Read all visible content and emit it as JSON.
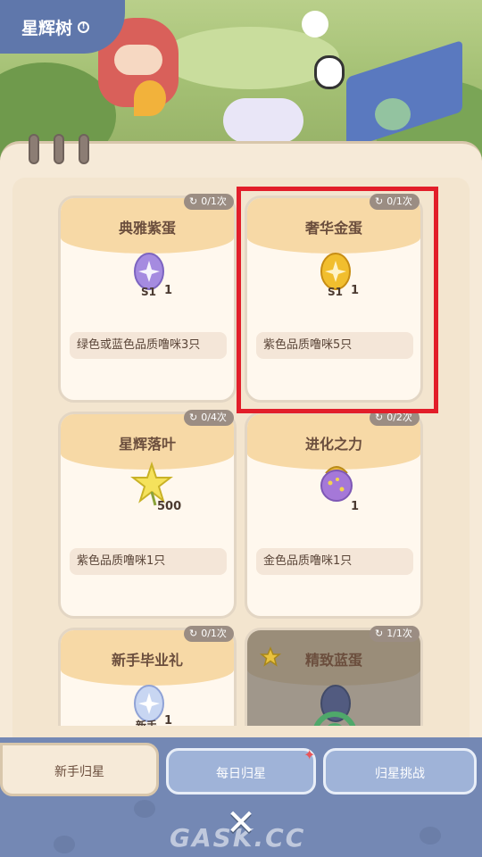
{
  "header": {
    "title": "星辉树",
    "info_icon": "info-icon"
  },
  "tabs": [
    {
      "label": "新手归星",
      "active": true
    },
    {
      "label": "每日归星",
      "active": false
    },
    {
      "label": "归星挑战",
      "active": false
    }
  ],
  "cards": [
    {
      "name": "典雅紫蛋",
      "limit": "0/1次",
      "reward_icon": "purple-egg-icon",
      "qty": "1",
      "condition": "绿色或蓝色品质噜咪3只"
    },
    {
      "name": "奢华金蛋",
      "limit": "0/1次",
      "reward_icon": "gold-egg-icon",
      "qty": "1",
      "condition": "紫色品质噜咪5只"
    },
    {
      "name": "星辉落叶",
      "limit": "0/4次",
      "reward_icon": "star-leaf-icon",
      "qty": "500",
      "condition": "紫色品质噜咪1只"
    },
    {
      "name": "进化之力",
      "limit": "0/2次",
      "reward_icon": "evolution-fruit-icon",
      "qty": "1",
      "condition": "金色品质噜咪1只"
    },
    {
      "name": "新手毕业礼",
      "limit": "0/1次",
      "reward_icon": "graduation-egg-icon",
      "qty": "1",
      "egg_tag": "新手"
    },
    {
      "name": "精致蓝蛋",
      "limit": "1/1次",
      "reward_icon": "blue-egg-icon",
      "completed": true
    }
  ],
  "egg_tag_s1": "S1",
  "watermark": "GASK.CC",
  "colors": {
    "highlight": "#e21e2a",
    "panel": "#f6ead8",
    "tab_blue": "#9fb3d8"
  }
}
